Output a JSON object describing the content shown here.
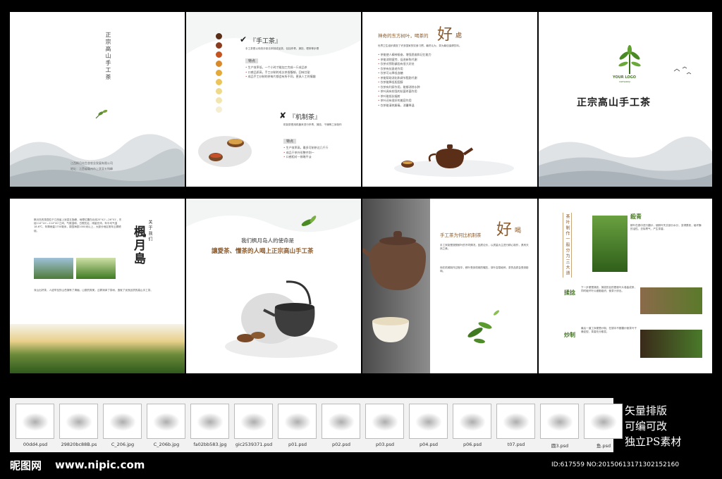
{
  "top_row": {
    "cover_back": {
      "vertical_title": "正宗高山手工茶",
      "address_lines": [
        "江西枫月岛生态农业发展有限公司",
        "地址：江西省赣州市上犹县五指峰"
      ]
    },
    "handmade_panel": {
      "heading": "『手工茶』",
      "intro": "手工茶是以传统手制法来制成品茶，包括杀青、揉捻、理条等步骤",
      "features_label": "特点",
      "features": [
        "生产效率低，一个小时才能加工完成一斤成品茶",
        "口感品质高，手工炒制的毛尖茶香馥郁，回味甘甜",
        "成品手工炒制的茶每片都会有所不同，更具人工的情趣"
      ],
      "machine_heading": "『机制茶』",
      "machine_intro": "机制茶是用机器来进行杀青、揉捻、干燥等工序制作",
      "machine_features_label": "特点",
      "machine_features": [
        "生产效率高，最多可制茶达几千斤",
        "成品干茶外形整齐划一",
        "口感相对一致略平淡"
      ]
    },
    "leaf_panel": {
      "subtitle": "神奇的东方树叶，喝茶的",
      "big_char": "好",
      "big_char_small": "處",
      "paragraph": "世界卫生组织调查了许多国家的饮食习惯，最终认为，茶为最佳保健饮料。",
      "bullets": [
        "茶能使人精神振奋，增强思维和记忆能力",
        "茶能消除疲劳、促进新陈代谢",
        "饮茶对预防龋齿有很大好处",
        "饮茶有抗衰老作用",
        "饮茶可以降低血糖",
        "茶能帮助消化和调节脂肪代谢",
        "饮茶能降低胆固醇",
        "饮茶有利尿作用，能够消除水肿",
        "茶叶具有较强的抗菌杀菌作用",
        "茶叶能抵抗辐射",
        "茶叶还有很好的美容作用",
        "饮茶能清热解毒，消暑降温"
      ]
    },
    "front_cover": {
      "logo_top": "YOUR LOGO",
      "logo_bottom": "company",
      "title": "正宗高山手工茶"
    }
  },
  "bottom_row": {
    "intro_panel": {
      "paragraph_1": "枫月岛的茶园位于江西省上犹县五指峰，地理位置在北纬25°42'—26°01'，东经114°14'—114°40'之间，气候温和，日照充足，雨量充沛，年平均气温18.6℃，年降雨量1750毫米，茶园海拔1000米以上，大部分地区常年云雾缭绕。",
      "paragraph_2": "深山出好茶，人迹罕至的山岳拥有了清幽，山丽的秀美，云雾润泽了茶树，造就了优良品质的高山手工茶。",
      "vertical_small": "关于我们",
      "vertical_big": "楓月島"
    },
    "mission_panel": {
      "line_1": "我们枫月岛人的使命是",
      "line_2": "讓愛茶、懂茶的人喝上正宗高山手工茶"
    },
    "compare_panel": {
      "subtitle": "手工茶为何比机制茶",
      "big_char": "好",
      "big_char_small": "喝",
      "paragraph_1": "手工采制是按照鲜叶的不同情况，因质论价，以质量为主进行精心制作，具有天然之美。",
      "paragraph_2": "而在机械制作过程中，鲜叶受到机械的碾压，芽叶容易破碎，茶的品质会受到影响。"
    },
    "process_panel": {
      "vertical_caption": "茶叶制作一般分为三大道",
      "steps": [
        {
          "name": "殺青",
          "text": "鲜叶在锅中进行翻炒，使鲜叶失去部分水分，变得柔软，破坏酶的活性，去除青气，产生茶香。"
        },
        {
          "name": "揉捻",
          "text": "下一步便是揉捻，揉捻的目的是使叶片卷曲成条，同时破坏叶片细胞组织，使茶汁渗出。"
        },
        {
          "name": "炒制",
          "text": "最后一道工序便是炒制，在锅中不断翻炒使茶叶干燥定型，茶香充分散发。"
        }
      ]
    }
  },
  "file_strip": {
    "files": [
      "00dd4.psd",
      "29820bc88B.ps",
      "C_206.jpg",
      "C_206b.jpg",
      "fa02bb583.jpg",
      "gic2539371.psd",
      "p01.psd",
      "p02.psd",
      "p03.psd",
      "p04.psd",
      "p06.psd",
      "t07.psd",
      "圆3.psd",
      "鱼.psd"
    ]
  },
  "promo": {
    "lines": [
      "矢量排版",
      "可编可改",
      "独立PS素材"
    ]
  },
  "footer": {
    "site_logo": "昵图网",
    "site_url": "www.nipic.com",
    "id_text": "ID:617559 NO:20150613171302152160"
  },
  "colors": {
    "accent_red": "#c0392b",
    "ink_green": "#4a7a2a",
    "ink_brown": "#8a5a2c"
  }
}
